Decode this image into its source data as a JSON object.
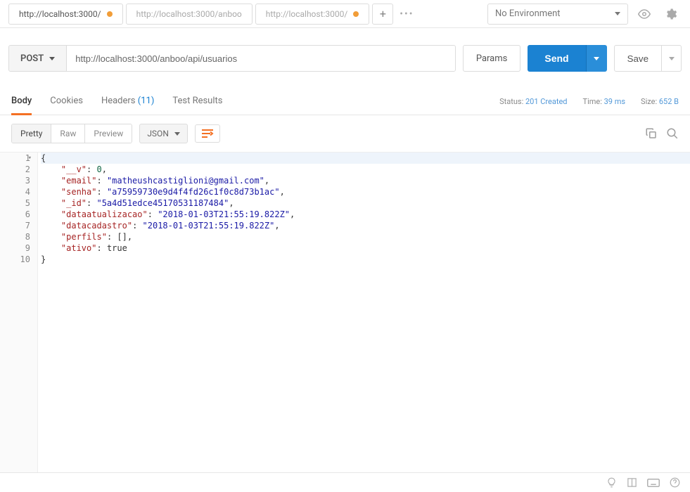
{
  "tabs": [
    {
      "label": "http://localhost:3000/",
      "dirty": true,
      "active": true
    },
    {
      "label": "http://localhost:3000/anboo",
      "dirty": false,
      "active": false
    },
    {
      "label": "http://localhost:3000/",
      "dirty": true,
      "active": false
    }
  ],
  "environment": {
    "selected": "No Environment"
  },
  "request": {
    "method": "POST",
    "url": "http://localhost:3000/anboo/api/usuarios",
    "params_label": "Params",
    "send_label": "Send",
    "save_label": "Save"
  },
  "response_tabs": {
    "body": "Body",
    "cookies": "Cookies",
    "headers": "Headers",
    "headers_count": "(11)",
    "test_results": "Test Results"
  },
  "response_status": {
    "status_label": "Status:",
    "status_value": "201 Created",
    "time_label": "Time:",
    "time_value": "39 ms",
    "size_label": "Size:",
    "size_value": "652 B"
  },
  "view": {
    "pretty": "Pretty",
    "raw": "Raw",
    "preview": "Preview",
    "format": "JSON"
  },
  "body_json": {
    "line_numbers": [
      "1",
      "2",
      "3",
      "4",
      "5",
      "6",
      "7",
      "8",
      "9",
      "10"
    ],
    "tokens": [
      [
        [
          "punc",
          "{"
        ]
      ],
      [
        [
          "indent",
          "    "
        ],
        [
          "key",
          "\"__v\""
        ],
        [
          "punc",
          ": "
        ],
        [
          "num",
          "0"
        ],
        [
          "punc",
          ","
        ]
      ],
      [
        [
          "indent",
          "    "
        ],
        [
          "key",
          "\"email\""
        ],
        [
          "punc",
          ": "
        ],
        [
          "str",
          "\"matheushcastiglioni@gmail.com\""
        ],
        [
          "punc",
          ","
        ]
      ],
      [
        [
          "indent",
          "    "
        ],
        [
          "key",
          "\"senha\""
        ],
        [
          "punc",
          ": "
        ],
        [
          "str",
          "\"a75959730e9d4f4fd26c1f0c8d73b1ac\""
        ],
        [
          "punc",
          ","
        ]
      ],
      [
        [
          "indent",
          "    "
        ],
        [
          "key",
          "\"_id\""
        ],
        [
          "punc",
          ": "
        ],
        [
          "str",
          "\"5a4d51edce45170531187484\""
        ],
        [
          "punc",
          ","
        ]
      ],
      [
        [
          "indent",
          "    "
        ],
        [
          "key",
          "\"dataatualizacao\""
        ],
        [
          "punc",
          ": "
        ],
        [
          "str",
          "\"2018-01-03T21:55:19.822Z\""
        ],
        [
          "punc",
          ","
        ]
      ],
      [
        [
          "indent",
          "    "
        ],
        [
          "key",
          "\"datacadastro\""
        ],
        [
          "punc",
          ": "
        ],
        [
          "str",
          "\"2018-01-03T21:55:19.822Z\""
        ],
        [
          "punc",
          ","
        ]
      ],
      [
        [
          "indent",
          "    "
        ],
        [
          "key",
          "\"perfils\""
        ],
        [
          "punc",
          ": []"
        ],
        [
          "punc",
          ","
        ]
      ],
      [
        [
          "indent",
          "    "
        ],
        [
          "key",
          "\"ativo\""
        ],
        [
          "punc",
          ": "
        ],
        [
          "bool",
          "true"
        ]
      ],
      [
        [
          "punc",
          "}"
        ]
      ]
    ]
  }
}
